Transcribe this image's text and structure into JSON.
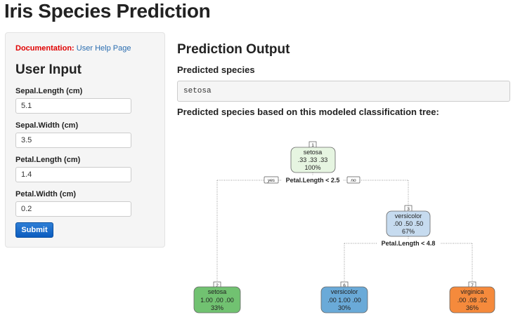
{
  "app": {
    "title": "Iris Species Prediction"
  },
  "sidebar": {
    "doc_label": "Documentation:",
    "doc_link": "User Help Page",
    "heading": "User Input",
    "fields": [
      {
        "label": "Sepal.Length (cm)",
        "value": "5.1"
      },
      {
        "label": "Sepal.Width (cm)",
        "value": "3.5"
      },
      {
        "label": "Petal.Length (cm)",
        "value": "1.4"
      },
      {
        "label": "Petal.Width (cm)",
        "value": "0.2"
      }
    ],
    "submit_label": "Submit"
  },
  "main": {
    "heading": "Prediction Output",
    "predicted_label": "Predicted species",
    "predicted_value": "setosa",
    "tree_label": "Predicted species based on this modeled classification tree:"
  },
  "tree": {
    "colors": {
      "setosa": "#71c271",
      "versicolor": "#6aaad8",
      "virginica": "#f58a3c",
      "root_fill": "#e6f5e1",
      "node3_fill": "#c6dbef"
    },
    "nodes": [
      {
        "id": "1",
        "class": "setosa",
        "probs": ".33  .33  .33",
        "pct": "100%"
      },
      {
        "id": "3",
        "class": "versicolor",
        "probs": ".00  .50  .50",
        "pct": "67%"
      },
      {
        "id": "2",
        "class": "setosa",
        "probs": "1.00  .00  .00",
        "pct": "33%"
      },
      {
        "id": "6",
        "class": "versicolor",
        "probs": ".00  1.00  .00",
        "pct": "30%"
      },
      {
        "id": "7",
        "class": "virginica",
        "probs": ".00  .08  .92",
        "pct": "36%"
      }
    ],
    "splits": [
      {
        "text": "Petal.Length < 2.5",
        "yes": "yes",
        "no": "no"
      },
      {
        "text": "Petal.Length < 4.8"
      }
    ]
  }
}
